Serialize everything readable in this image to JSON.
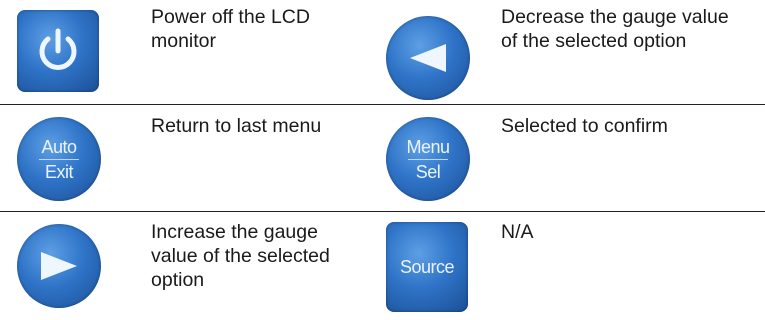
{
  "rows": [
    {
      "left_icon": "power-icon",
      "left_text": "Power off the LCD monitor",
      "right_icon": "left-arrow-icon",
      "right_text": "Decrease the gauge value of the selected option"
    },
    {
      "left_icon": "auto-exit-icon",
      "left_text": "Return to last menu",
      "right_icon": "menu-sel-icon",
      "right_text": "Selected to confirm"
    },
    {
      "left_icon": "right-arrow-icon",
      "left_text": "Increase the gauge value of the selected option",
      "right_icon": "source-icon",
      "right_text": "N/A"
    }
  ],
  "buttons": {
    "auto": "Auto",
    "exit": "Exit",
    "menu": "Menu",
    "sel": "Sel",
    "source": "Source"
  },
  "colors": {
    "button_blue": "#2f74c8",
    "rule": "#222222"
  }
}
